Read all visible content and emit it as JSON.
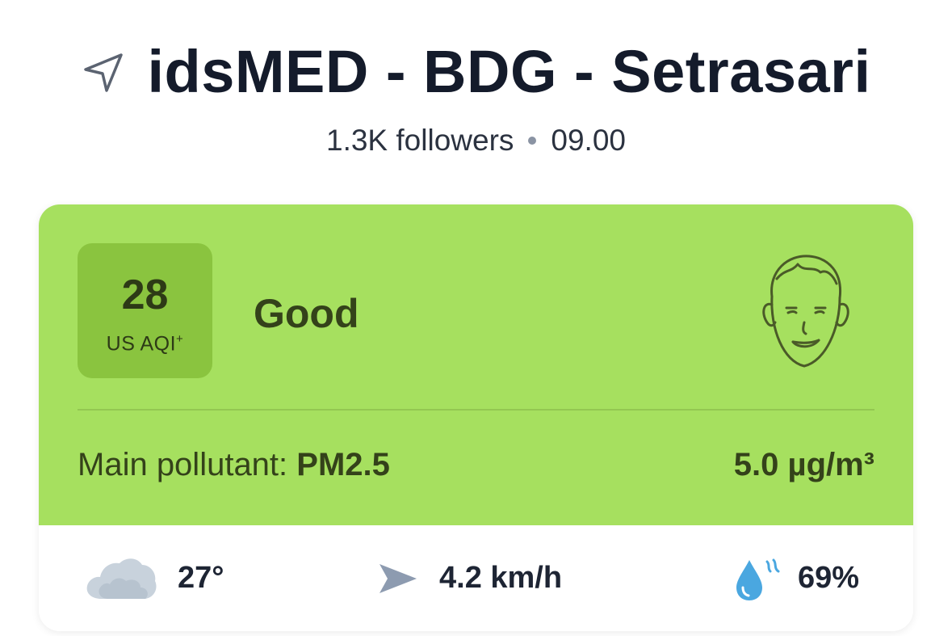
{
  "header": {
    "title": "idsMED - BDG - Setrasari",
    "followers": "1.3K followers",
    "time": "09.00",
    "location_icon": "location-arrow-icon"
  },
  "aqi": {
    "value": "28",
    "unit": "US AQI",
    "unit_sup": "+",
    "status": "Good",
    "face_icon": "happy-face-icon",
    "colors": {
      "card_background": "#a6e05f",
      "value_box": "#8ac43f",
      "text": "#34421a"
    }
  },
  "pollutant": {
    "label": "Main pollutant: ",
    "name": "PM2.5",
    "concentration": "5.0 µg/m³"
  },
  "weather": {
    "temperature": "27°",
    "temperature_icon": "cloud-icon",
    "wind": "4.2 km/h",
    "wind_icon": "wind-direction-icon",
    "humidity": "69%",
    "humidity_icon": "humidity-drop-icon"
  }
}
